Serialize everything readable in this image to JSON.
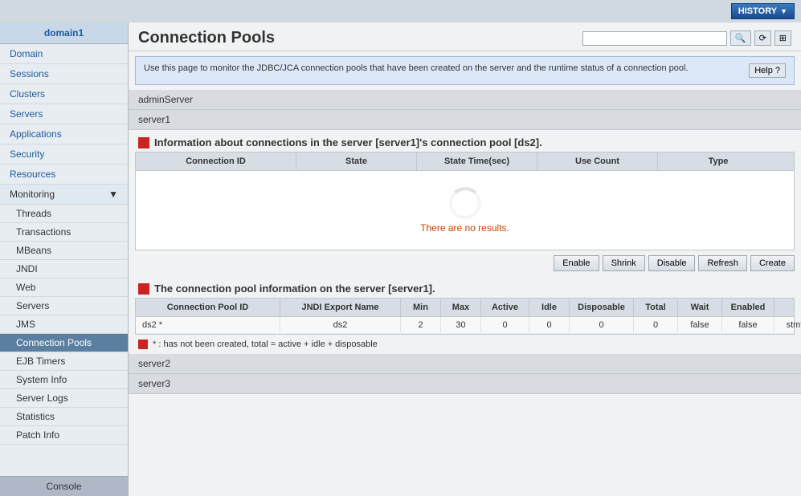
{
  "topBar": {
    "historyLabel": "HISTORY"
  },
  "sidebar": {
    "domain": "domain1",
    "items": [
      {
        "label": "Domain",
        "id": "domain"
      },
      {
        "label": "Sessions",
        "id": "sessions"
      },
      {
        "label": "Clusters",
        "id": "clusters"
      },
      {
        "label": "Servers",
        "id": "servers"
      },
      {
        "label": "Applications",
        "id": "applications"
      },
      {
        "label": "Security",
        "id": "security"
      },
      {
        "label": "Resources",
        "id": "resources"
      },
      {
        "label": "Monitoring",
        "id": "monitoring"
      }
    ],
    "monitoringItems": [
      {
        "label": "Threads",
        "id": "threads"
      },
      {
        "label": "Transactions",
        "id": "transactions"
      },
      {
        "label": "MBeans",
        "id": "mbeans"
      },
      {
        "label": "JNDI",
        "id": "jndi"
      },
      {
        "label": "Web",
        "id": "web"
      },
      {
        "label": "Servers",
        "id": "servers2"
      },
      {
        "label": "JMS",
        "id": "jms"
      },
      {
        "label": "Connection Pools",
        "id": "connection-pools",
        "active": true
      },
      {
        "label": "EJB Timers",
        "id": "ejb-timers"
      },
      {
        "label": "System Info",
        "id": "system-info"
      },
      {
        "label": "Server Logs",
        "id": "server-logs"
      },
      {
        "label": "Statistics",
        "id": "statistics"
      },
      {
        "label": "Patch Info",
        "id": "patch-info"
      }
    ],
    "console": "Console"
  },
  "content": {
    "title": "Connection Pools",
    "searchPlaceholder": "",
    "infoBanner": "Use this page to monitor the JDBC/JCA connection pools that have been created on the server and the runtime status of a connection pool.",
    "helpLabel": "Help ?",
    "servers": [
      "adminServer",
      "server1"
    ],
    "section1": {
      "title": "Information about connections in the server [server1]'s connection pool [ds2].",
      "columns": [
        "Connection ID",
        "State",
        "State Time(sec)",
        "Use Count",
        "Type"
      ],
      "noResults": "There are no results."
    },
    "actionButtons": [
      "Enable",
      "Shrink",
      "Disable",
      "Refresh",
      "Create"
    ],
    "section2": {
      "title": "The connection pool information on the server [server1].",
      "columns": [
        "Connection Pool ID",
        "JNDI Export Name",
        "Min",
        "Max",
        "Active",
        "Idle",
        "Disposable",
        "Total",
        "Wait",
        "Enabled",
        ""
      ],
      "rows": [
        {
          "poolId": "ds2 *",
          "jndi": "ds2",
          "min": "2",
          "max": "30",
          "active": "0",
          "idle": "0",
          "disposable": "0",
          "total": "0",
          "wait": "false",
          "enabled": "false",
          "extra": "stmt"
        }
      ]
    },
    "footnote": "* : has not been created, total = active + idle + disposable",
    "additionalServers": [
      "server2",
      "server3"
    ]
  }
}
